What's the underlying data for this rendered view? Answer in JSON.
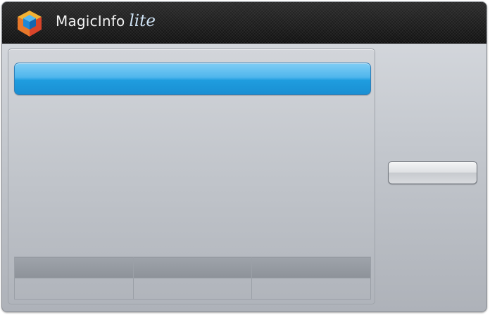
{
  "app": {
    "name": "MagicInfo",
    "edition": "lite"
  },
  "icons": {
    "logo": "magicinfo-cube-icon"
  },
  "colors": {
    "accent_blue": "#1f9ddf",
    "titlebar_dark": "#1b1b1b",
    "panel_gray": "#c4c8ce"
  },
  "table": {
    "columns": 3,
    "rows": [
      [
        "",
        "",
        ""
      ],
      [
        "",
        "",
        ""
      ]
    ]
  }
}
